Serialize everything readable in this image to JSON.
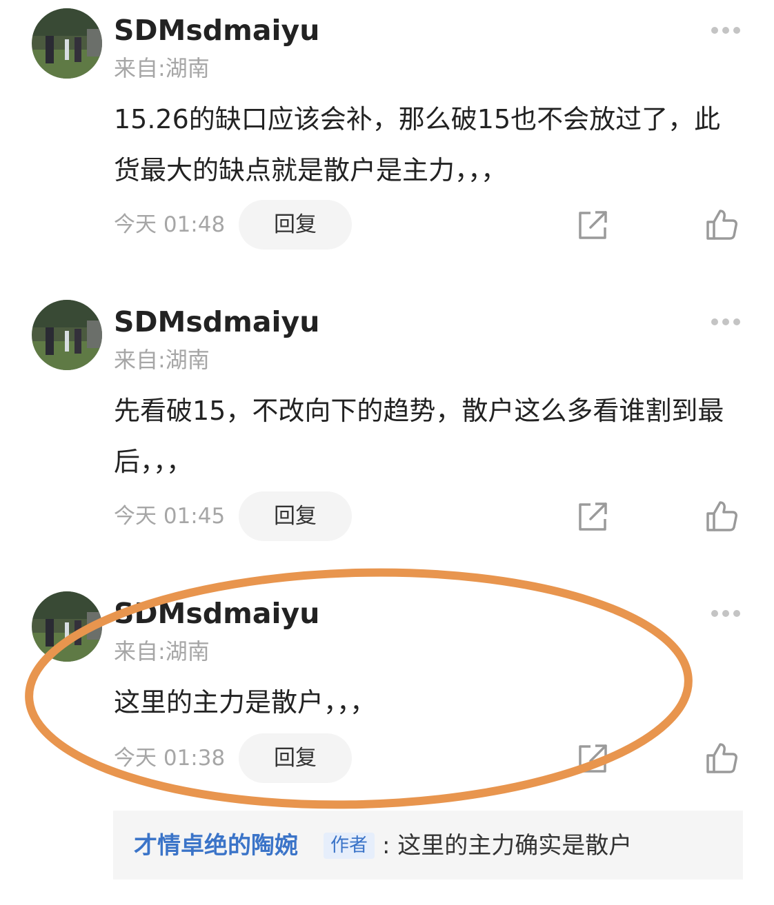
{
  "comments": [
    {
      "username": "SDMsdmaiyu",
      "location": "来自:湖南",
      "text": "15.26的缺口应该会补，那么破15也不会放过了，此货最大的缺点就是散户是主力，，，",
      "time": "今天 01:48",
      "reply_label": "回复",
      "more_icon": "more-horizontal-icon",
      "share_icon": "share-icon",
      "like_icon": "thumbs-up-icon"
    },
    {
      "username": "SDMsdmaiyu",
      "location": "来自:湖南",
      "text": "先看破15，不改向下的趋势，散户这么多看谁割到最后，，，",
      "time": "今天 01:45",
      "reply_label": "回复",
      "more_icon": "more-horizontal-icon",
      "share_icon": "share-icon",
      "like_icon": "thumbs-up-icon"
    },
    {
      "username": "SDMsdmaiyu",
      "location": "来自:湖南",
      "text": "这里的主力是散户，，，",
      "time": "今天 01:38",
      "reply_label": "回复",
      "more_icon": "more-horizontal-icon",
      "share_icon": "share-icon",
      "like_icon": "thumbs-up-icon",
      "sub_reply": {
        "author": "才情卓绝的陶婉",
        "badge": "作者",
        "text": ": 这里的主力确实是散户"
      }
    }
  ],
  "colors": {
    "highlight_ellipse": "#e8954e",
    "reply_author": "#3b74c8",
    "secondary_text": "#a6a6a6"
  }
}
